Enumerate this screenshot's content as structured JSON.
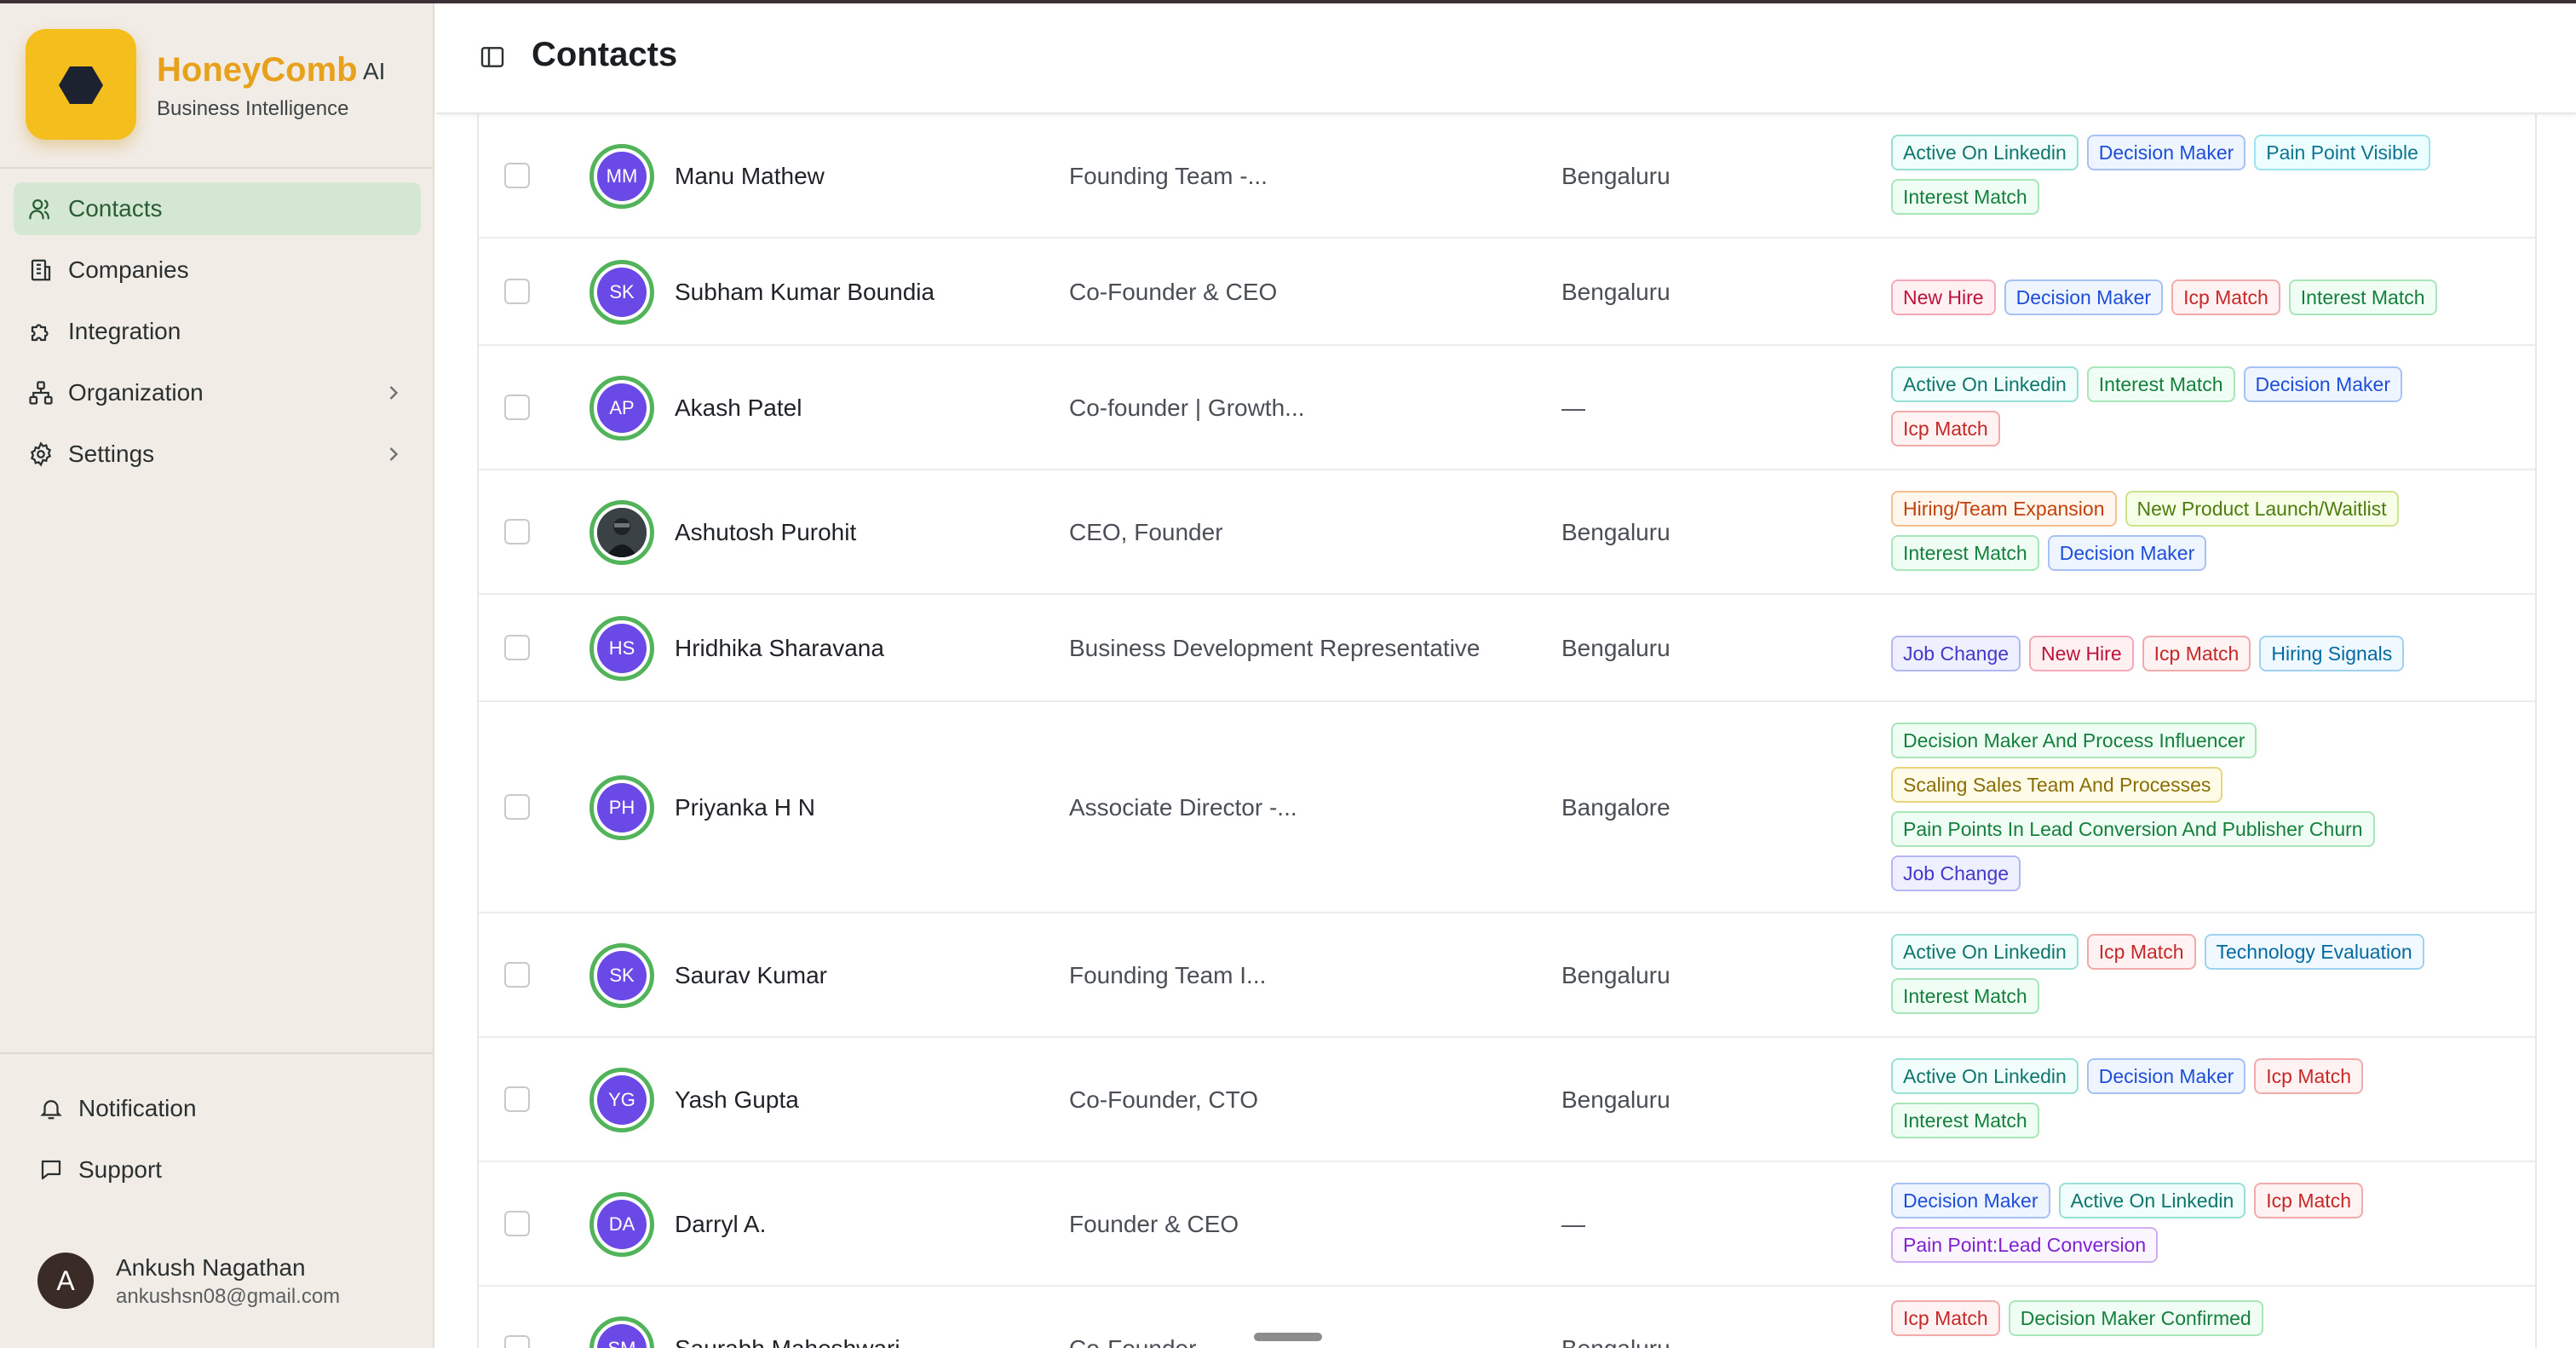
{
  "brand": {
    "name": "HoneyComb",
    "suffix": "AI",
    "subtitle": "Business Intelligence"
  },
  "sidebar": {
    "items": [
      {
        "label": "Contacts",
        "icon": "users-icon",
        "active": true
      },
      {
        "label": "Companies",
        "icon": "building-icon"
      },
      {
        "label": "Integration",
        "icon": "puzzle-icon"
      },
      {
        "label": "Organization",
        "icon": "org-chart-icon",
        "has_submenu": true
      },
      {
        "label": "Settings",
        "icon": "gear-icon",
        "has_submenu": true
      }
    ],
    "bottom": {
      "notification": "Notification",
      "support": "Support"
    },
    "user": {
      "initial": "A",
      "name": "Ankush Nagathan",
      "email": "ankushsn08@gmail.com"
    }
  },
  "header": {
    "title": "Contacts"
  },
  "contacts": [
    {
      "initials": "MM",
      "name": "Manu Mathew",
      "title": "Founding Team -...",
      "location": "Bengaluru",
      "tags": [
        "Active On Linkedin",
        "Decision Maker",
        "Pain Point Visible",
        "Interest Match"
      ]
    },
    {
      "initials": "SK",
      "name": "Subham Kumar Boundia",
      "title": "Co-Founder & CEO",
      "location": "Bengaluru",
      "tags": [
        "New Hire",
        "Decision Maker",
        "Icp Match",
        "Interest Match"
      ]
    },
    {
      "initials": "AP",
      "name": "Akash Patel",
      "title": "Co-founder | Growth...",
      "location": "—",
      "tags": [
        "Active On Linkedin",
        "Interest Match",
        "Decision Maker",
        "Icp Match"
      ]
    },
    {
      "initials": "",
      "name": "Ashutosh Purohit",
      "title": "CEO, Founder",
      "location": "Bengaluru",
      "tags": [
        "Hiring/Team Expansion",
        "New Product Launch/Waitlist",
        "Interest Match",
        "Decision Maker"
      ]
    },
    {
      "initials": "HS",
      "name": "Hridhika Sharavana",
      "title": "Business Development Representative",
      "location": "Bengaluru",
      "tags": [
        "Job Change",
        "New Hire",
        "Icp Match",
        "Hiring Signals"
      ]
    },
    {
      "initials": "PH",
      "name": "Priyanka H N",
      "title": "Associate Director -...",
      "location": "Bangalore",
      "tags": [
        "Decision Maker And Process Influencer",
        "Scaling Sales Team And Processes",
        "Pain Points In Lead Conversion And Publisher Churn",
        "Job Change"
      ]
    },
    {
      "initials": "SK",
      "name": "Saurav Kumar",
      "title": "Founding Team I...",
      "location": "Bengaluru",
      "tags": [
        "Active On Linkedin",
        "Icp Match",
        "Technology Evaluation",
        "Interest Match"
      ]
    },
    {
      "initials": "YG",
      "name": "Yash Gupta",
      "title": "Co-Founder, CTO",
      "location": "Bengaluru",
      "tags": [
        "Active On Linkedin",
        "Decision Maker",
        "Icp Match",
        "Interest Match"
      ]
    },
    {
      "initials": "DA",
      "name": "Darryl A.",
      "title": "Founder & CEO",
      "location": "—",
      "tags": [
        "Decision Maker",
        "Active On Linkedin",
        "Icp Match",
        "Pain Point:Lead Conversion"
      ]
    },
    {
      "initials": "SM",
      "name": "Saurabh Maheshwari",
      "title": "Co-Founder",
      "location": "Bengaluru",
      "tags": [
        "Icp Match",
        "Decision Maker Confirmed"
      ]
    }
  ],
  "tag_colors": {
    "Active On Linkedin": "#0f766e",
    "Decision Maker": "#1d4ed8",
    "Pain Point Visible": "#0e7490",
    "Interest Match": "#15803d",
    "New Hire": "#be123c",
    "Icp Match": "#c62828",
    "Hiring/Team Expansion": "#c2410c",
    "New Product Launch/Waitlist": "#4d7c0f",
    "Job Change": "#4338ca",
    "Hiring Signals": "#0369a1",
    "Decision Maker And Process Influencer": "#15803d",
    "Scaling Sales Team And Processes": "#8a6d04",
    "Pain Points In Lead Conversion And Publisher Churn": "#15803d",
    "Technology Evaluation": "#0369a1",
    "Pain Point:Lead Conversion": "#7e22ce",
    "Decision Maker Confirmed": "#15803d"
  }
}
